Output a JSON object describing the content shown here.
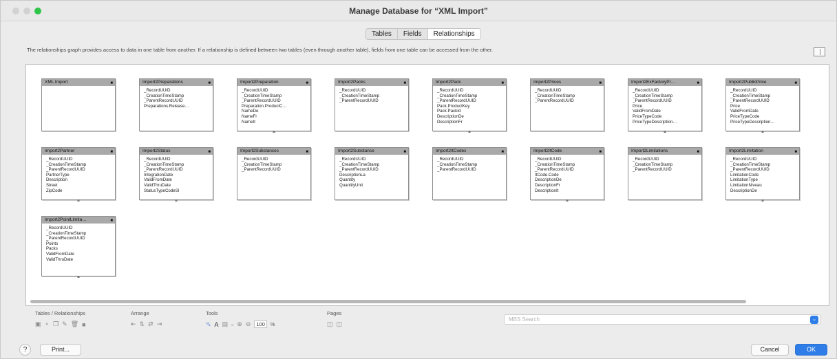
{
  "window": {
    "title": "Manage Database for “XML Import”"
  },
  "tabs": [
    {
      "label": "Tables",
      "active": false
    },
    {
      "label": "Fields",
      "active": false
    },
    {
      "label": "Relationships",
      "active": true
    }
  ],
  "description": "The relationships graph provides access to data in one table from another. If a relationship is defined between two tables (even through another table), fields from one table can be accessed from the other.",
  "graph": {
    "tables": [
      {
        "name": "XML Import",
        "fields": []
      },
      {
        "name": "Import2Preparations",
        "fields": [
          "_RecordUUID",
          "_CreationTimeStamp",
          "_ParentRecordUUID",
          "Preparations.Release…"
        ]
      },
      {
        "name": "Import2Preparation",
        "fields": [
          "_RecordUUID",
          "_CreationTimeStamp",
          "_ParentRecordUUID",
          "Preparation.ProductC…",
          "NameDe",
          "NameFr",
          "NameIt"
        ]
      },
      {
        "name": "Import2Packs",
        "fields": [
          "_RecordUUID",
          "_CreationTimeStamp",
          "_ParentRecordUUID"
        ]
      },
      {
        "name": "Import2Pack",
        "fields": [
          "_RecordUUID",
          "_CreationTimeStamp",
          "_ParentRecordUUID",
          "Pack.ProductKey",
          "Pack.PackId",
          "DescriptionDe",
          "DescriptionFr"
        ]
      },
      {
        "name": "Import2Prices",
        "fields": [
          "_RecordUUID",
          "_CreationTimeStamp",
          "_ParentRecordUUID"
        ]
      },
      {
        "name": "Import2ExFactoryPr…",
        "fields": [
          "_RecordUUID",
          "_CreationTimeStamp",
          "_ParentRecordUUID",
          "Price",
          "ValidFromDate",
          "PriceTypeCode",
          "PriceTypeDescription…"
        ]
      },
      {
        "name": "Import2PublicPrice",
        "fields": [
          "_RecordUUID",
          "_CreationTimeStamp",
          "_ParentRecordUUID",
          "Price",
          "ValidFromDate",
          "PriceTypeCode",
          "PriceTypeDescription…"
        ]
      },
      {
        "name": "Import2Partner",
        "fields": [
          "_RecordUUID",
          "_CreationTimeStamp",
          "_ParentRecordUUID",
          "PartnerType",
          "Description",
          "Street",
          "ZipCode"
        ]
      },
      {
        "name": "Import2Status",
        "fields": [
          "_RecordUUID",
          "_CreationTimeStamp",
          "_ParentRecordUUID",
          "IntegrationDate",
          "ValidFromDate",
          "ValidThruDate",
          "StatusTypeCodeSl"
        ]
      },
      {
        "name": "Import2Substances",
        "fields": [
          "_RecordUUID",
          "_CreationTimeStamp",
          "_ParentRecordUUID"
        ]
      },
      {
        "name": "Import2Substance",
        "fields": [
          "_RecordUUID",
          "_CreationTimeStamp",
          "_ParentRecordUUID",
          "DescriptionLa",
          "Quantity",
          "QuantityUnit"
        ]
      },
      {
        "name": "Import2ItCodes",
        "fields": [
          "_RecordUUID",
          "_CreationTimeStamp",
          "_ParentRecordUUID"
        ]
      },
      {
        "name": "Import2ItCode",
        "fields": [
          "_RecordUUID",
          "_CreationTimeStamp",
          "_ParentRecordUUID",
          "ItCode.Code",
          "DescriptionDe",
          "DescriptionFr",
          "DescriptionIt"
        ]
      },
      {
        "name": "Import2Limitations",
        "fields": [
          "_RecordUUID",
          "_CreationTimeStamp",
          "_ParentRecordUUID"
        ]
      },
      {
        "name": "Import2Limitation",
        "fields": [
          "_RecordUUID",
          "_CreationTimeStamp",
          "_ParentRecordUUID",
          "LimitationCode",
          "LimitationType",
          "LimitationNiveau",
          "DescriptionDe"
        ]
      },
      {
        "name": "Import2PointLimita…",
        "fields": [
          "_RecordUUID",
          "_CreationTimeStamp",
          "_ParentRecordUUID",
          "Points",
          "Packs",
          "ValidFromDate",
          "ValidThruDate"
        ]
      }
    ]
  },
  "toolbar": {
    "tables_relationships_label": "Tables / Relationships",
    "arrange_label": "Arrange",
    "tools_label": "Tools",
    "pages_label": "Pages",
    "zoom_value": "100",
    "zoom_unit": "%"
  },
  "search": {
    "placeholder": "MBS Search"
  },
  "footer": {
    "help_label": "?",
    "print_label": "Print...",
    "cancel_label": "Cancel",
    "ok_label": "OK"
  },
  "colors": {
    "accent": "#2f7ee8",
    "table_header": "#a9a9a9",
    "traffic_green": "#2ec549"
  }
}
